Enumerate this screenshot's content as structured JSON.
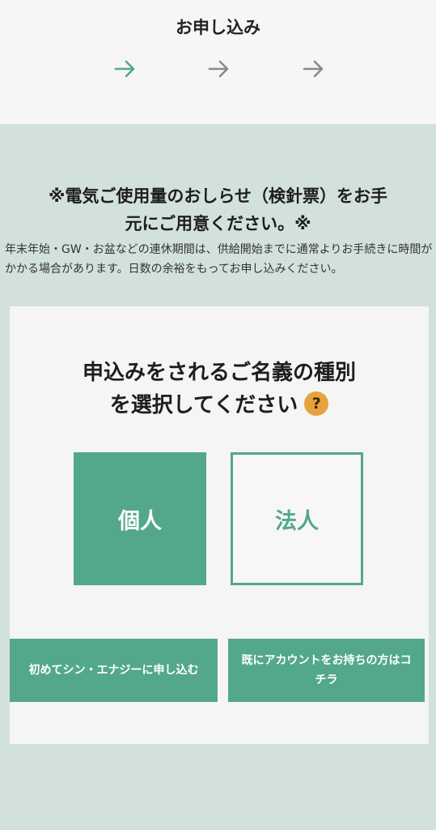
{
  "header": {
    "title": "お申し込み",
    "step_arrows": [
      "arrow-right-icon",
      "arrow-right-icon",
      "arrow-right-icon"
    ],
    "arrow_colors": [
      "#53a88a",
      "#8a8a8a",
      "#8a8a8a"
    ]
  },
  "notice": {
    "line1": "※電気ご使用量のおしらせ（検針票）をお手",
    "line2": "元にご用意ください。※"
  },
  "subnote": "年末年始・GW・お盆などの連休期間は、供給開始までに通常よりお手続きに時間がかかる場合があります。日数の余裕をもってお申し込みください。",
  "card": {
    "question_line1": "申込みをされるご名義の種別",
    "question_line2": "を選択してください",
    "help_icon": "?",
    "choices": {
      "individual": "個人",
      "corporate": "法人"
    },
    "actions": {
      "new_signup": "初めてシン・エナジーに申し込む",
      "existing_account": "既にアカウントをお持ちの方はコチラ"
    }
  },
  "colors": {
    "accent": "#53a88a",
    "background": "#d3e1dc",
    "header_bg": "#f6f6f4",
    "card_bg": "#f5f5f3",
    "help_icon": "#e6a23c"
  }
}
